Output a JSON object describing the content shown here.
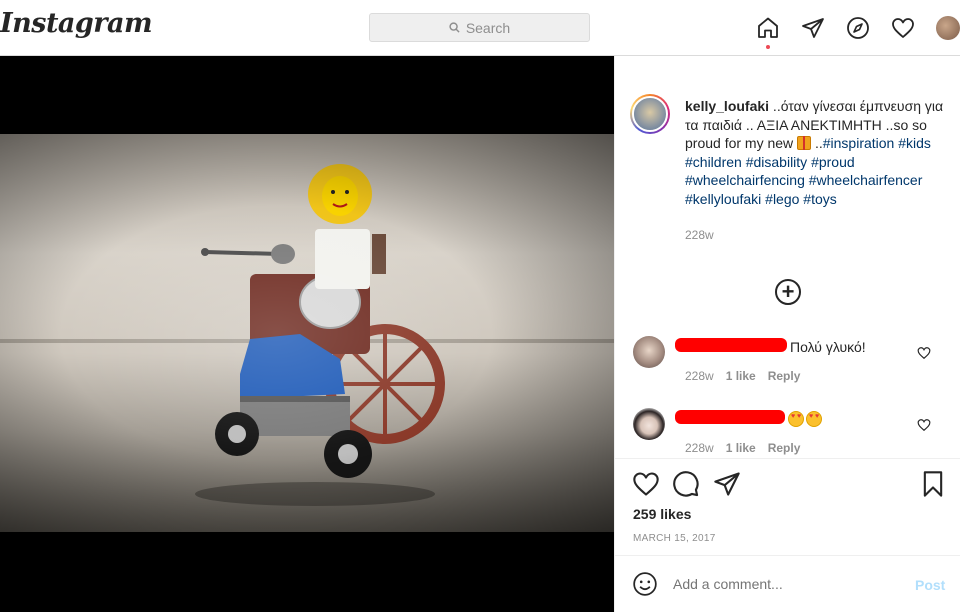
{
  "header": {
    "logo": "Instagram",
    "search_placeholder": "Search"
  },
  "post": {
    "caption": {
      "username": "kelly_loufaki",
      "text": " ..όταν γίνεσαι έμπνευση για τα παιδιά .. ΑΞΙΑ ΑΝΕΚΤΙΜΗΤΗ ..so so proud for my new ",
      "text_after_emoji": " ..",
      "hashtags": "#inspiration #kids #children #disability #proud #wheelchairfencing #wheelchairfencer #kellyloufaki #lego #toys",
      "time": "228w"
    },
    "comments": [
      {
        "text": "Πολύ γλυκό!",
        "time": "228w",
        "likes": "1 like",
        "reply": "Reply"
      },
      {
        "text": "",
        "time": "228w",
        "likes": "1 like",
        "reply": "Reply"
      }
    ],
    "likes": "259 likes",
    "date": "MARCH 15, 2017",
    "add_comment_placeholder": "Add a comment...",
    "post_label": "Post"
  },
  "colors": {
    "accent": "#0095f6",
    "hashtag": "#00376b",
    "notification_dot": "#ed4956"
  }
}
